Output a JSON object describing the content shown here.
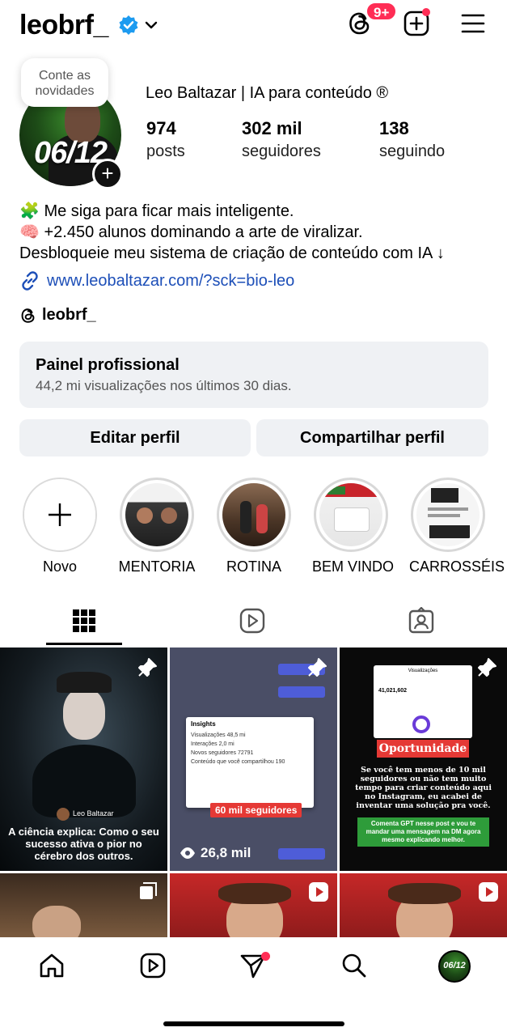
{
  "header": {
    "username": "leobrf_",
    "notification_badge": "9+"
  },
  "profile": {
    "note_bubble": "Conte as novidades",
    "avatar_label": "06/12",
    "full_name": "Leo Baltazar | IA para conteúdo ®",
    "stats": [
      {
        "value": "974",
        "label": "posts"
      },
      {
        "value": "302 mil",
        "label": "seguidores"
      },
      {
        "value": "138",
        "label": "seguindo"
      }
    ],
    "bio": [
      "🧩 Me siga para ficar mais inteligente.",
      "🧠 +2.450 alunos dominando a arte de viralizar.",
      "Desbloqueie meu sistema de criação de conteúdo com IA ↓"
    ],
    "link": "www.leobaltazar.com/?sck=bio-leo",
    "threads_handle": "leobrf_"
  },
  "panel": {
    "title": "Painel profissional",
    "subtitle": "44,2 mi visualizações nos últimos 30 dias."
  },
  "buttons": {
    "edit": "Editar perfil",
    "share": "Compartilhar perfil"
  },
  "highlights": [
    {
      "label": "Novo"
    },
    {
      "label": "MENTORIA"
    },
    {
      "label": "ROTINA"
    },
    {
      "label": "BEM VINDO"
    },
    {
      "label": "CARROSSÉIS"
    }
  ],
  "posts": [
    {
      "caption": "A ciência explica: Como o seu sucesso ativa o pior no cérebro dos outros.",
      "author": "Leo Baltazar"
    },
    {
      "badge": "60 mil seguidores",
      "views": "26,8 mil",
      "insights_title": "Insights",
      "insights_lines": [
        "Visualizações 48,5 mi",
        "Interações 2,0 mi",
        "Novos seguidores 72791",
        "Conteúdo que você compartilhou 190"
      ]
    },
    {
      "stat_title": "Visualizações",
      "stat_value": "41,021,602",
      "tag": "Oportunidade",
      "body": "Se você tem menos de 10 mil seguidores ou não tem muito tempo para criar conteúdo aqui no Instagram, eu acabei de inventar uma solução pra você.",
      "cta": "Comenta GPT nesse post e vou te mandar uma mensagem na DM agora mesmo explicando melhor."
    }
  ],
  "bottom_nav_avatar_label": "06/12",
  "colors": {
    "verified": "#1d9bf0",
    "badge": "#ff2d55",
    "link": "#1d4fb8",
    "panel_bg": "#eff1f4"
  }
}
